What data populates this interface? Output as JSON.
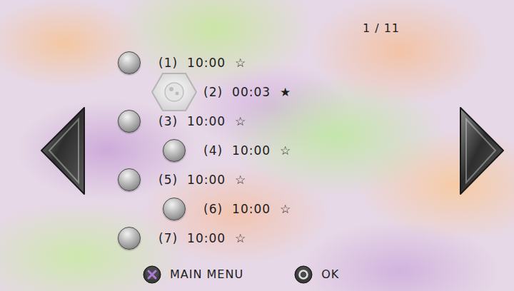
{
  "page": {
    "indicator": "1 / 11"
  },
  "entries": [
    {
      "index": "(1)",
      "time": "10:00",
      "star": "☆",
      "selected": false
    },
    {
      "index": "(2)",
      "time": "00:03",
      "star": "★",
      "selected": true
    },
    {
      "index": "(3)",
      "time": "10:00",
      "star": "☆",
      "selected": false
    },
    {
      "index": "(4)",
      "time": "10:00",
      "star": "☆",
      "selected": false
    },
    {
      "index": "(5)",
      "time": "10:00",
      "star": "☆",
      "selected": false
    },
    {
      "index": "(6)",
      "time": "10:00",
      "star": "☆",
      "selected": false
    },
    {
      "index": "(7)",
      "time": "10:00",
      "star": "☆",
      "selected": false
    }
  ],
  "buttons": [
    {
      "label": "MAIN MENU",
      "kind": "cross"
    },
    {
      "label": "OK",
      "kind": "circle"
    }
  ]
}
